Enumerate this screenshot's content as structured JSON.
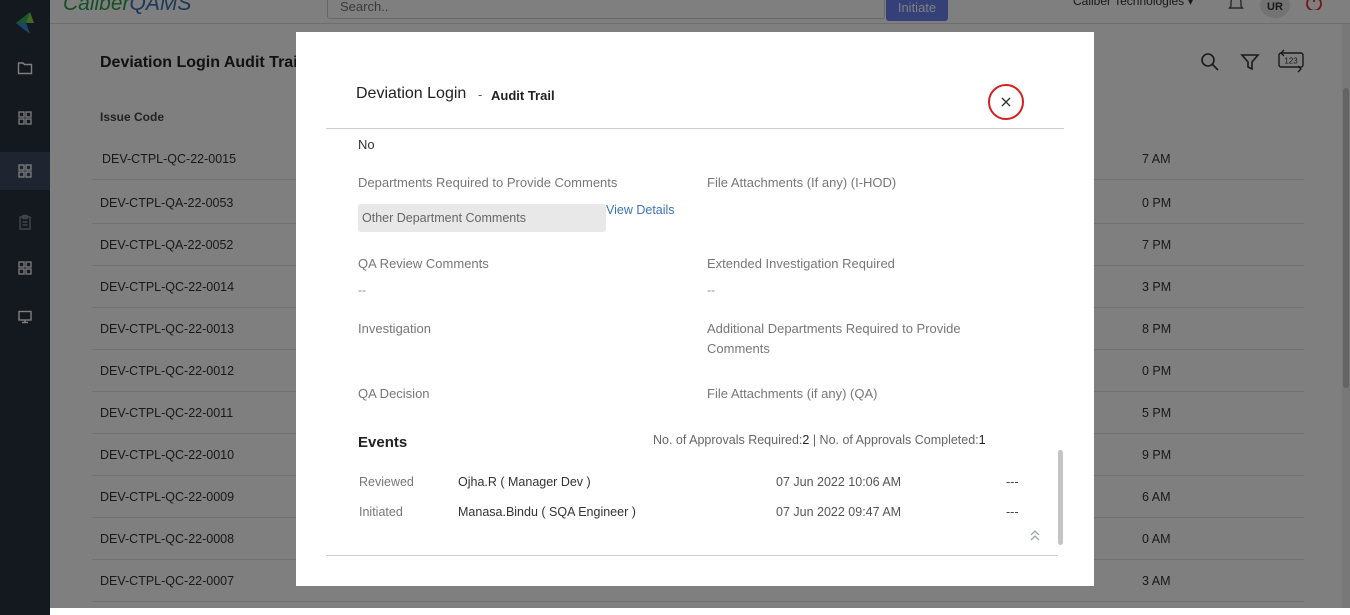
{
  "app": {
    "brand_main": "Caliber",
    "brand_suffix": "QAMS",
    "search_placeholder": "Search..",
    "initiate_label": "Initiate",
    "company": "Caliber Technologies",
    "avatar_initials": "UR"
  },
  "page": {
    "title": "Deviation Login Audit Trail",
    "column_header": "Issue Code",
    "rows": [
      {
        "code": "DEV-CTPL-QC-22-0015",
        "time": "7 AM"
      },
      {
        "code": "DEV-CTPL-QA-22-0053",
        "time": "0 PM"
      },
      {
        "code": "DEV-CTPL-QA-22-0052",
        "time": "7 PM"
      },
      {
        "code": "DEV-CTPL-QC-22-0014",
        "time": "3 PM"
      },
      {
        "code": "DEV-CTPL-QC-22-0013",
        "time": "8 PM"
      },
      {
        "code": "DEV-CTPL-QC-22-0012",
        "time": "0 PM"
      },
      {
        "code": "DEV-CTPL-QC-22-0011",
        "time": "5 PM"
      },
      {
        "code": "DEV-CTPL-QC-22-0010",
        "time": "9 PM"
      },
      {
        "code": "DEV-CTPL-QC-22-0009",
        "time": "6 AM"
      },
      {
        "code": "DEV-CTPL-QC-22-0008",
        "time": "0 AM"
      },
      {
        "code": "DEV-CTPL-QC-22-0007",
        "time": "3 AM"
      }
    ]
  },
  "modal": {
    "title": "Deviation Login",
    "separator": "-",
    "subtitle": "Audit Trail",
    "top_value": "No",
    "fields": {
      "dept_required_label": "Departments Required to Provide Comments",
      "dept_chip": "Other Department Comments",
      "view_details": "View Details",
      "file_att_ihod_label": "File Attachments (If any) (I-HOD)",
      "qa_review_label": "QA Review Comments",
      "qa_review_value": "--",
      "ext_invest_label": "Extended Investigation Required",
      "ext_invest_value": "--",
      "investigation_label": "Investigation",
      "add_depts_label_1": "Additional Departments Required to Provide",
      "add_depts_label_2": "Comments",
      "qa_decision_label": "QA Decision",
      "file_att_qa_label": "File Attachments (if any) (QA)"
    },
    "events": {
      "title": "Events",
      "approvals_required_label": "No. of Approvals Required:",
      "approvals_required": "2",
      "approvals_separator": " | ",
      "approvals_completed_label": "No. of Approvals Completed:",
      "approvals_completed": "1",
      "rows": [
        {
          "action": "Reviewed",
          "user": "Ojha.R ( Manager Dev )",
          "date": "07 Jun 2022 10:06 AM",
          "note": "---"
        },
        {
          "action": "Initiated",
          "user": "Manasa.Bindu ( SQA Engineer )",
          "date": "07 Jun 2022 09:47 AM",
          "note": "---"
        }
      ]
    }
  },
  "colors": {
    "sidebar": "#28323f",
    "accent": "#6a7ef1",
    "close_ring": "#d32020",
    "link": "#3a73b8"
  }
}
